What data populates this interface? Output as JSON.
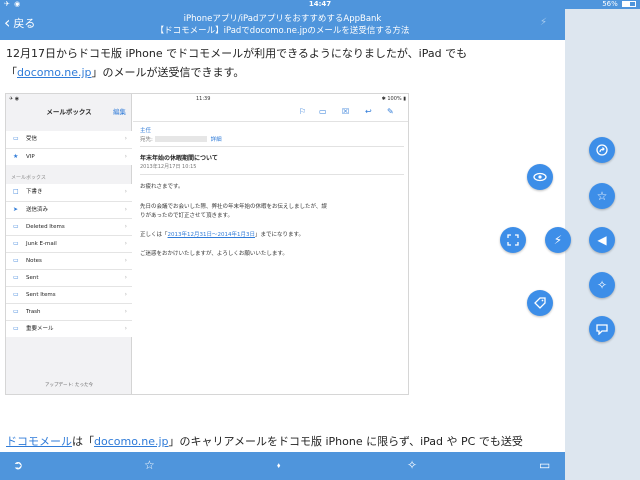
{
  "status_bar": {
    "signal": "✈ ◉",
    "time": "14:47",
    "battery": "56%",
    "battery_level": 0.56
  },
  "nav": {
    "back_label": "戻る",
    "title_line1": "iPhoneアプリ/iPadアプリをおすすめするAppBank",
    "title_line2": "【ドコモメール】iPadでdocomo.ne.jpのメールを送受信する方法"
  },
  "article": {
    "p1_a": "12月17日からドコモ版 iPhone でドコモメールが利用できるようになりましたが、iPad でも",
    "p1_b_open": "「",
    "p1_b_link": "docomo.ne.jp",
    "p1_b_rest": "」のメールが送受信できます。",
    "p2_link1": "ドコモメール",
    "p2_mid": "は「",
    "p2_link2": "docomo.ne.jp",
    "p2_rest": "」のキャリアメールをドコモ版 iPhone に限らず、iPad や PC でも送受"
  },
  "screenshot": {
    "status_left": "✈ ◉",
    "status_time": "11:39",
    "status_right": "✱ 100% ▮",
    "mailboxes_title": "メールボックス",
    "edit_label": "編集",
    "top_items": [
      {
        "label": "受信",
        "icon": "inbox-icon"
      },
      {
        "label": "VIP",
        "icon": "star-icon"
      }
    ],
    "section_label": "メールボックス",
    "folders": [
      {
        "label": "下書き",
        "icon": "draft-icon"
      },
      {
        "label": "送信済み",
        "icon": "sent-icon"
      },
      {
        "label": "Deleted Items",
        "icon": "folder-icon"
      },
      {
        "label": "Junk E-mail",
        "icon": "folder-icon"
      },
      {
        "label": "Notes",
        "icon": "folder-icon"
      },
      {
        "label": "Sent",
        "icon": "folder-icon"
      },
      {
        "label": "Sent Items",
        "icon": "folder-icon"
      },
      {
        "label": "Trash",
        "icon": "folder-icon"
      },
      {
        "label": "重要メール",
        "icon": "folder-icon"
      }
    ],
    "footer": "アップデート: たった今",
    "from": "主任",
    "to_prefix": "宛先:",
    "details": "詳細",
    "subject": "年末年始の休暇期間について",
    "date": "2013年12月17日 10:15",
    "body_greeting": "お疲れさまです。",
    "body_p1_l1": "先日の会議でお会いした際、弊社の年末年始の休暇をお伝えしましたが、誤",
    "body_p1_l2": "りがあったので訂正させて頂きます。",
    "body_p2_a": "正しくは「",
    "body_p2_link": "2013年12月31日〜2014年1月3日",
    "body_p2_b": "」までになります。",
    "body_closing": "ご迷惑をおかけいたしますが、よろしくお願いいたします。"
  },
  "icons": {
    "back": "chevron-left-icon",
    "bolt": "lightning-icon",
    "eye": "eye-icon",
    "share": "share-icon",
    "star": "star-icon",
    "expand": "expand-icon",
    "lightning": "lightning-icon",
    "back_arrow": "triangle-left-icon",
    "tag": "tag-icon",
    "pin": "pin-icon",
    "comment": "comment-icon"
  },
  "colors": {
    "nav_blue": "#4f95dc",
    "fab_blue": "#3d8ee8",
    "link_blue": "#2f7bd8",
    "panel_bg": "#dde6ef"
  }
}
